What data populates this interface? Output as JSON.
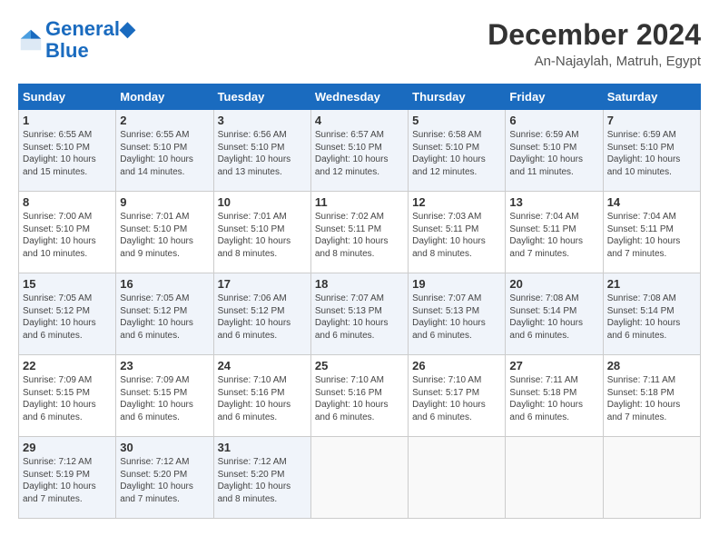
{
  "header": {
    "logo_line1": "General",
    "logo_line2": "Blue",
    "month": "December 2024",
    "location": "An-Najaylah, Matruh, Egypt"
  },
  "weekdays": [
    "Sunday",
    "Monday",
    "Tuesday",
    "Wednesday",
    "Thursday",
    "Friday",
    "Saturday"
  ],
  "weeks": [
    [
      {
        "day": "1",
        "info": "Sunrise: 6:55 AM\nSunset: 5:10 PM\nDaylight: 10 hours\nand 15 minutes."
      },
      {
        "day": "2",
        "info": "Sunrise: 6:55 AM\nSunset: 5:10 PM\nDaylight: 10 hours\nand 14 minutes."
      },
      {
        "day": "3",
        "info": "Sunrise: 6:56 AM\nSunset: 5:10 PM\nDaylight: 10 hours\nand 13 minutes."
      },
      {
        "day": "4",
        "info": "Sunrise: 6:57 AM\nSunset: 5:10 PM\nDaylight: 10 hours\nand 12 minutes."
      },
      {
        "day": "5",
        "info": "Sunrise: 6:58 AM\nSunset: 5:10 PM\nDaylight: 10 hours\nand 12 minutes."
      },
      {
        "day": "6",
        "info": "Sunrise: 6:59 AM\nSunset: 5:10 PM\nDaylight: 10 hours\nand 11 minutes."
      },
      {
        "day": "7",
        "info": "Sunrise: 6:59 AM\nSunset: 5:10 PM\nDaylight: 10 hours\nand 10 minutes."
      }
    ],
    [
      {
        "day": "8",
        "info": "Sunrise: 7:00 AM\nSunset: 5:10 PM\nDaylight: 10 hours\nand 10 minutes."
      },
      {
        "day": "9",
        "info": "Sunrise: 7:01 AM\nSunset: 5:10 PM\nDaylight: 10 hours\nand 9 minutes."
      },
      {
        "day": "10",
        "info": "Sunrise: 7:01 AM\nSunset: 5:10 PM\nDaylight: 10 hours\nand 8 minutes."
      },
      {
        "day": "11",
        "info": "Sunrise: 7:02 AM\nSunset: 5:11 PM\nDaylight: 10 hours\nand 8 minutes."
      },
      {
        "day": "12",
        "info": "Sunrise: 7:03 AM\nSunset: 5:11 PM\nDaylight: 10 hours\nand 8 minutes."
      },
      {
        "day": "13",
        "info": "Sunrise: 7:04 AM\nSunset: 5:11 PM\nDaylight: 10 hours\nand 7 minutes."
      },
      {
        "day": "14",
        "info": "Sunrise: 7:04 AM\nSunset: 5:11 PM\nDaylight: 10 hours\nand 7 minutes."
      }
    ],
    [
      {
        "day": "15",
        "info": "Sunrise: 7:05 AM\nSunset: 5:12 PM\nDaylight: 10 hours\nand 6 minutes."
      },
      {
        "day": "16",
        "info": "Sunrise: 7:05 AM\nSunset: 5:12 PM\nDaylight: 10 hours\nand 6 minutes."
      },
      {
        "day": "17",
        "info": "Sunrise: 7:06 AM\nSunset: 5:12 PM\nDaylight: 10 hours\nand 6 minutes."
      },
      {
        "day": "18",
        "info": "Sunrise: 7:07 AM\nSunset: 5:13 PM\nDaylight: 10 hours\nand 6 minutes."
      },
      {
        "day": "19",
        "info": "Sunrise: 7:07 AM\nSunset: 5:13 PM\nDaylight: 10 hours\nand 6 minutes."
      },
      {
        "day": "20",
        "info": "Sunrise: 7:08 AM\nSunset: 5:14 PM\nDaylight: 10 hours\nand 6 minutes."
      },
      {
        "day": "21",
        "info": "Sunrise: 7:08 AM\nSunset: 5:14 PM\nDaylight: 10 hours\nand 6 minutes."
      }
    ],
    [
      {
        "day": "22",
        "info": "Sunrise: 7:09 AM\nSunset: 5:15 PM\nDaylight: 10 hours\nand 6 minutes."
      },
      {
        "day": "23",
        "info": "Sunrise: 7:09 AM\nSunset: 5:15 PM\nDaylight: 10 hours\nand 6 minutes."
      },
      {
        "day": "24",
        "info": "Sunrise: 7:10 AM\nSunset: 5:16 PM\nDaylight: 10 hours\nand 6 minutes."
      },
      {
        "day": "25",
        "info": "Sunrise: 7:10 AM\nSunset: 5:16 PM\nDaylight: 10 hours\nand 6 minutes."
      },
      {
        "day": "26",
        "info": "Sunrise: 7:10 AM\nSunset: 5:17 PM\nDaylight: 10 hours\nand 6 minutes."
      },
      {
        "day": "27",
        "info": "Sunrise: 7:11 AM\nSunset: 5:18 PM\nDaylight: 10 hours\nand 6 minutes."
      },
      {
        "day": "28",
        "info": "Sunrise: 7:11 AM\nSunset: 5:18 PM\nDaylight: 10 hours\nand 7 minutes."
      }
    ],
    [
      {
        "day": "29",
        "info": "Sunrise: 7:12 AM\nSunset: 5:19 PM\nDaylight: 10 hours\nand 7 minutes."
      },
      {
        "day": "30",
        "info": "Sunrise: 7:12 AM\nSunset: 5:20 PM\nDaylight: 10 hours\nand 7 minutes."
      },
      {
        "day": "31",
        "info": "Sunrise: 7:12 AM\nSunset: 5:20 PM\nDaylight: 10 hours\nand 8 minutes."
      },
      {
        "day": "",
        "info": ""
      },
      {
        "day": "",
        "info": ""
      },
      {
        "day": "",
        "info": ""
      },
      {
        "day": "",
        "info": ""
      }
    ]
  ]
}
